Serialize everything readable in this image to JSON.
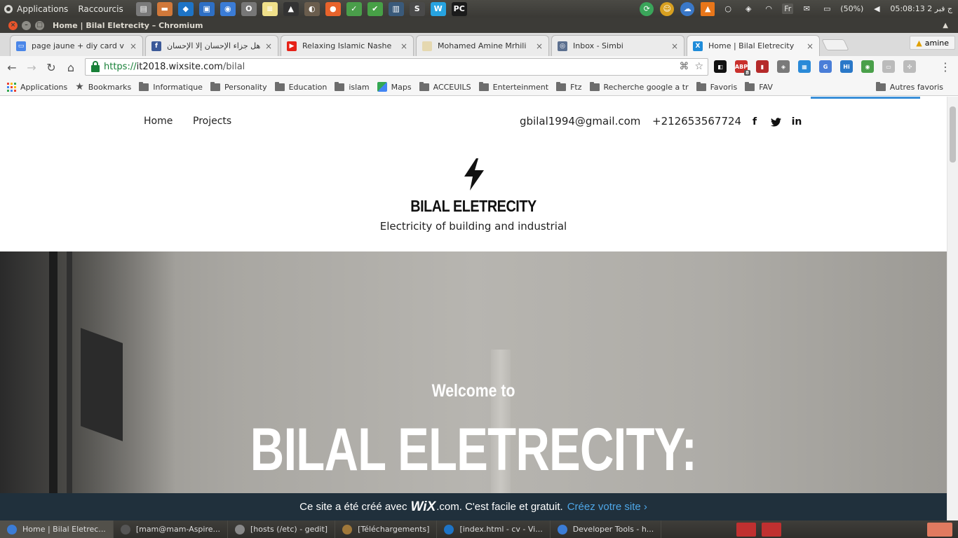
{
  "os_panel": {
    "applications_label": "Applications",
    "shortcuts_label": "Raccourcis",
    "launchers": [
      {
        "icon": "files-icon",
        "color": "#7a7a7a",
        "glyph": "▤"
      },
      {
        "icon": "folder-icon",
        "color": "#d0783a",
        "glyph": "▬"
      },
      {
        "icon": "vscode-icon",
        "color": "#1e74c6",
        "glyph": "◆"
      },
      {
        "icon": "vm-icon",
        "color": "#2e6fc4",
        "glyph": "▣"
      },
      {
        "icon": "chromium-icon",
        "color": "#3b7cd6",
        "glyph": "◉"
      },
      {
        "icon": "opera-icon",
        "color": "#777777",
        "glyph": "O"
      },
      {
        "icon": "notes-icon",
        "color": "#f0e08a",
        "glyph": "≡"
      },
      {
        "icon": "inkscape-icon",
        "color": "#333333",
        "glyph": "▲"
      },
      {
        "icon": "gimp-icon",
        "color": "#6a5d4d",
        "glyph": "◐"
      },
      {
        "icon": "firefox-icon",
        "color": "#e8632b",
        "glyph": "●"
      },
      {
        "icon": "check-app-icon",
        "color": "#4a9e4a",
        "glyph": "✓"
      },
      {
        "icon": "tasks-icon",
        "color": "#47a046",
        "glyph": "✔"
      },
      {
        "icon": "monitor-icon",
        "color": "#3a5a7a",
        "glyph": "▥"
      },
      {
        "icon": "sublime-icon",
        "color": "#4a4a4a",
        "glyph": "S"
      },
      {
        "icon": "webstorm-icon",
        "color": "#27a3e0",
        "glyph": "W"
      },
      {
        "icon": "pycharm-icon",
        "color": "#1b1b1b",
        "glyph": "PC"
      }
    ],
    "tray": {
      "battery": "(50%)",
      "keyboard": "Fr",
      "clock": "05:08:13 2 ج فبر"
    }
  },
  "window": {
    "title": "Home | Bilal Eletrecity – Chromium"
  },
  "tabs": [
    {
      "label": "page jaune + diy card v + w",
      "favicon": "doc-favicon",
      "color": "#4a86e8",
      "glyph": "▭"
    },
    {
      "label": "هل جزاء الإحسان إلا الإحسان",
      "favicon": "facebook-favicon",
      "color": "#3b5998",
      "glyph": "f"
    },
    {
      "label": "Relaxing Islamic Nashe",
      "favicon": "youtube-favicon",
      "color": "#e62117",
      "glyph": "▶"
    },
    {
      "label": "Mohamed Amine Mrhili",
      "favicon": "page-favicon",
      "color": "#e5d8b0",
      "glyph": ""
    },
    {
      "label": "Inbox - Simbi",
      "favicon": "simbi-favicon",
      "color": "#5b6f8f",
      "glyph": "◎"
    },
    {
      "label": "Home | Bilal Eletrecity",
      "favicon": "wix-favicon",
      "color": "#1e8bd9",
      "glyph": "X"
    }
  ],
  "profile_name": "amine",
  "address_bar": {
    "scheme": "https://",
    "host": "it2018.wixsite.com",
    "path": "/bilal"
  },
  "extensions": [
    {
      "icon": "pocket-ext-icon",
      "color": "#111111",
      "glyph": "◧",
      "badge": ""
    },
    {
      "icon": "adblock-ext-icon",
      "color": "#c9302c",
      "glyph": "ABP",
      "badge": "8"
    },
    {
      "icon": "bookmark-ext-icon",
      "color": "#b52a2a",
      "glyph": "▮",
      "badge": ""
    },
    {
      "icon": "shield-ext-icon",
      "color": "#7a7a7a",
      "glyph": "◈",
      "badge": ""
    },
    {
      "icon": "window-ext-icon",
      "color": "#2a8ad8",
      "glyph": "▦",
      "badge": ""
    },
    {
      "icon": "translate-ext-icon",
      "color": "#4a7ed8",
      "glyph": "G",
      "badge": ""
    },
    {
      "icon": "hi-ext-icon",
      "color": "#2a78c8",
      "glyph": "Hi",
      "badge": ""
    },
    {
      "icon": "eye-ext-icon",
      "color": "#4aa04a",
      "glyph": "◉",
      "badge": ""
    },
    {
      "icon": "screen-ext-icon",
      "color": "#bbbbbb",
      "glyph": "▭",
      "badge": ""
    },
    {
      "icon": "puzzle-ext-icon",
      "color": "#bbbbbb",
      "glyph": "✣",
      "badge": ""
    }
  ],
  "bookmarks": [
    {
      "label": "Applications",
      "kind": "apps"
    },
    {
      "label": "Bookmarks",
      "kind": "star"
    },
    {
      "label": "Informatique",
      "kind": "folder"
    },
    {
      "label": "Personality",
      "kind": "folder"
    },
    {
      "label": "Education",
      "kind": "folder"
    },
    {
      "label": "islam",
      "kind": "folder"
    },
    {
      "label": "Maps",
      "kind": "maps"
    },
    {
      "label": "ACCEUILS",
      "kind": "folder"
    },
    {
      "label": "Enterteinment",
      "kind": "folder"
    },
    {
      "label": "Ftz",
      "kind": "folder"
    },
    {
      "label": "Recherche google a tr",
      "kind": "folder"
    },
    {
      "label": "Favoris",
      "kind": "folder"
    },
    {
      "label": "FAV",
      "kind": "folder"
    }
  ],
  "other_bookmarks": "Autres favoris",
  "site": {
    "nav": {
      "home": "Home",
      "projects": "Projects"
    },
    "email": "gbilal1994@gmail.com",
    "phone": "+212653567724",
    "social": {
      "facebook": "f",
      "twitter": "🐦",
      "linkedin": "in"
    },
    "brand_name": "BILAL ELETRECITY",
    "tagline": "Electricity of building and industrial",
    "hero_welcome": "Welcome to",
    "hero_title": "BILAL ELETRECITY:",
    "wix_banner": {
      "prefix": "Ce site a été créé avec",
      "logo": "WiX",
      "suffix": ".com. C'est facile et gratuit.",
      "cta": "Créez votre site ›"
    }
  },
  "taskbar": [
    {
      "label": "Home | Bilal Eletrec...",
      "icon": "chromium-task-icon",
      "color": "#3b7cd6",
      "active": true
    },
    {
      "label": "[mam@mam-Aspire...",
      "icon": "terminal-task-icon",
      "color": "#555555",
      "active": false
    },
    {
      "label": "[hosts (/etc) - gedit]",
      "icon": "gedit-task-icon",
      "color": "#888888",
      "active": false
    },
    {
      "label": "[Téléchargements]",
      "icon": "files-task-icon",
      "color": "#a0783a",
      "active": false
    },
    {
      "label": "[index.html - cv - Vi...",
      "icon": "vscode-task-icon",
      "color": "#1e74c6",
      "active": false
    },
    {
      "label": "Developer Tools - h...",
      "icon": "devtools-task-icon",
      "color": "#3b7cd6",
      "active": false
    }
  ]
}
